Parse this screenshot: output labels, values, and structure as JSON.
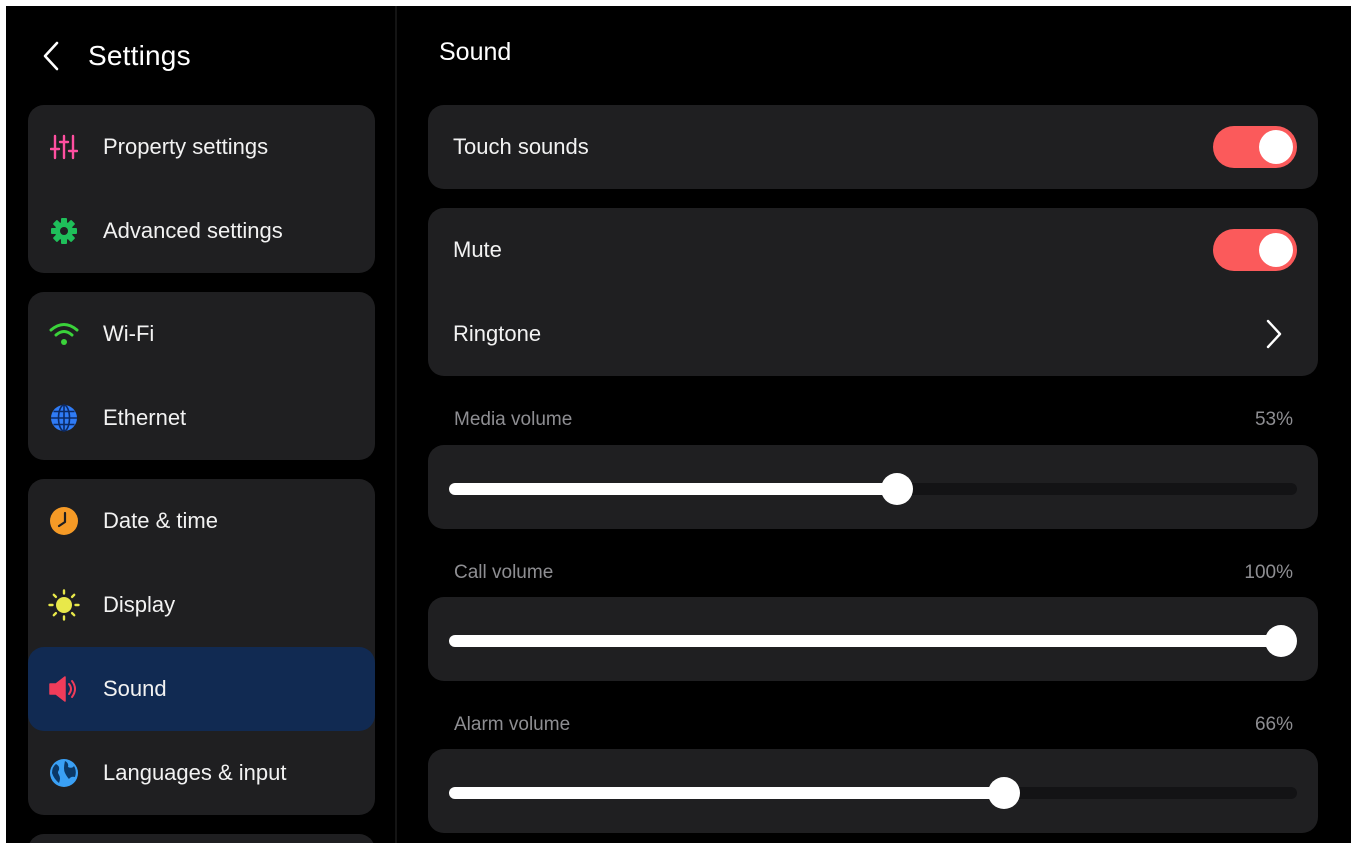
{
  "sidebar": {
    "title": "Settings",
    "groups": [
      {
        "items": [
          {
            "label": "Property settings",
            "icon": "sliders-icon",
            "color": "#ff4fa0"
          },
          {
            "label": "Advanced settings",
            "icon": "gear-icon",
            "color": "#1fbf5a"
          }
        ]
      },
      {
        "items": [
          {
            "label": "Wi-Fi",
            "icon": "wifi-icon",
            "color": "#3ad23a"
          },
          {
            "label": "Ethernet",
            "icon": "globe-icon",
            "color": "#2f7bf5"
          }
        ]
      },
      {
        "items": [
          {
            "label": "Date & time",
            "icon": "clock-icon",
            "color": "#f59a26"
          },
          {
            "label": "Display",
            "icon": "sun-icon",
            "color": "#e8e84a"
          },
          {
            "label": "Sound",
            "icon": "speaker-icon",
            "color": "#f03c5a",
            "active": true
          },
          {
            "label": "Languages & input",
            "icon": "earth-icon",
            "color": "#3aa0f5"
          }
        ]
      }
    ]
  },
  "main": {
    "title": "Sound",
    "touch_sounds": {
      "label": "Touch sounds",
      "on": true
    },
    "mute": {
      "label": "Mute",
      "on": true
    },
    "ringtone": {
      "label": "Ringtone"
    },
    "volumes": [
      {
        "label": "Media volume",
        "value_text": "53%",
        "level": 0.53
      },
      {
        "label": "Call volume",
        "value_text": "100%",
        "level": 1.0
      },
      {
        "label": "Alarm volume",
        "value_text": "66%",
        "level": 0.66
      }
    ]
  },
  "colors": {
    "accent_toggle": "#fb5a5b",
    "active_item_bg": "#112a52"
  }
}
